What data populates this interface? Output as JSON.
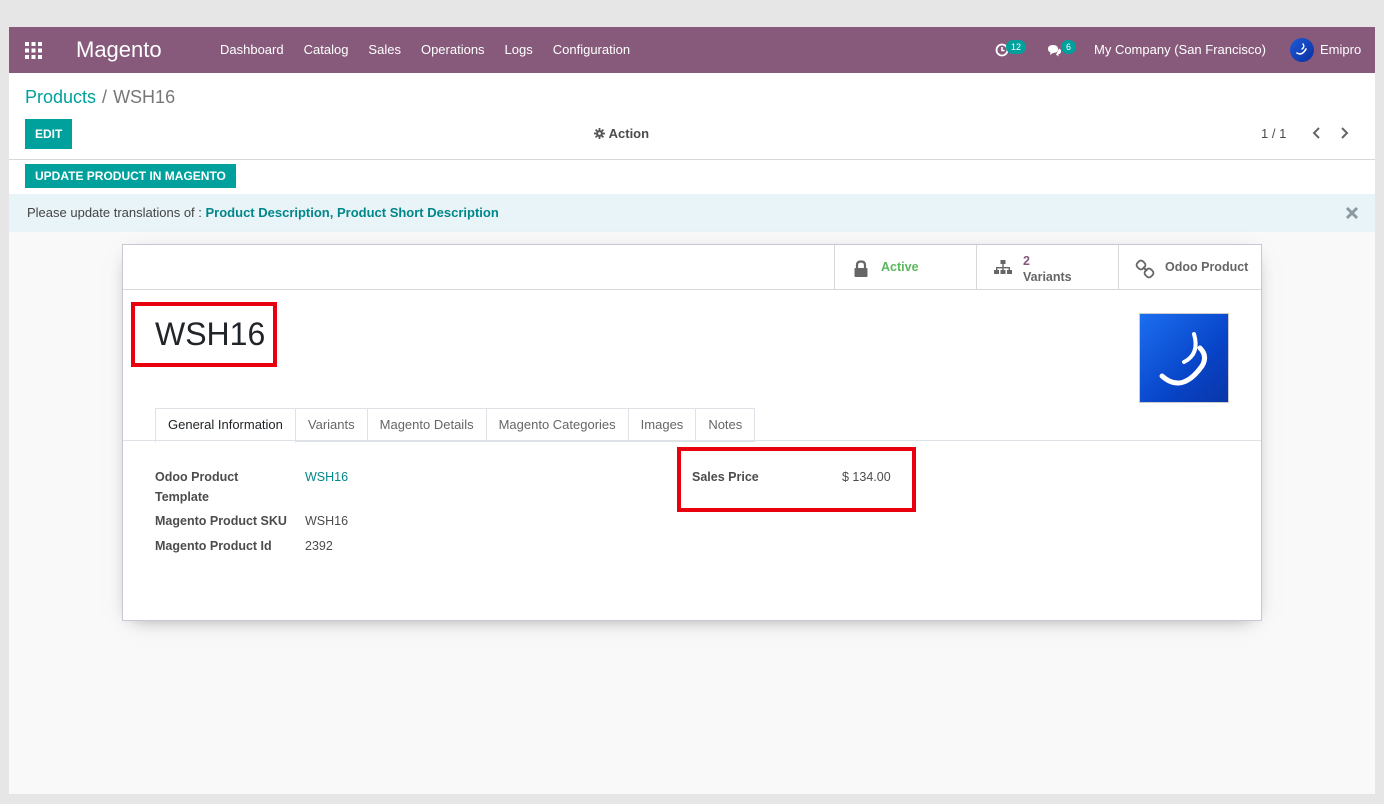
{
  "navbar": {
    "brand": "Magento",
    "menu": [
      "Dashboard",
      "Catalog",
      "Sales",
      "Operations",
      "Logs",
      "Configuration"
    ],
    "activity_count": "12",
    "messages_count": "6",
    "company": "My Company (San Francisco)",
    "user": "Emipro"
  },
  "breadcrumb": {
    "parent": "Products",
    "separator": "/",
    "current": "WSH16"
  },
  "control_panel": {
    "edit_label": "EDIT",
    "action_label": "Action",
    "pager": "1 / 1"
  },
  "header": {
    "update_label": "UPDATE PRODUCT IN MAGENTO"
  },
  "alert": {
    "prefix": "Please update translations of : ",
    "fields": "Product Description, Product Short Description"
  },
  "stat_buttons": {
    "active_label": "Active",
    "variants_count": "2",
    "variants_label": "Variants",
    "odoo_product_label": "Odoo Product"
  },
  "product": {
    "name": "WSH16"
  },
  "tabs": [
    "General Information",
    "Variants",
    "Magento Details",
    "Magento Categories",
    "Images",
    "Notes"
  ],
  "fields": {
    "template_label_1": "Odoo Product",
    "template_label_2": "Template",
    "template_value": "WSH16",
    "sku_label": "Magento Product SKU",
    "sku_value": "WSH16",
    "id_label": "Magento Product Id",
    "id_value": "2392",
    "price_label": "Sales Price",
    "price_value": "$ 134.00"
  },
  "colors": {
    "navbar": "#875a7b",
    "primary": "#00a09d",
    "highlight_box": "#e8000e",
    "alert_bg": "#e9f4f8"
  }
}
